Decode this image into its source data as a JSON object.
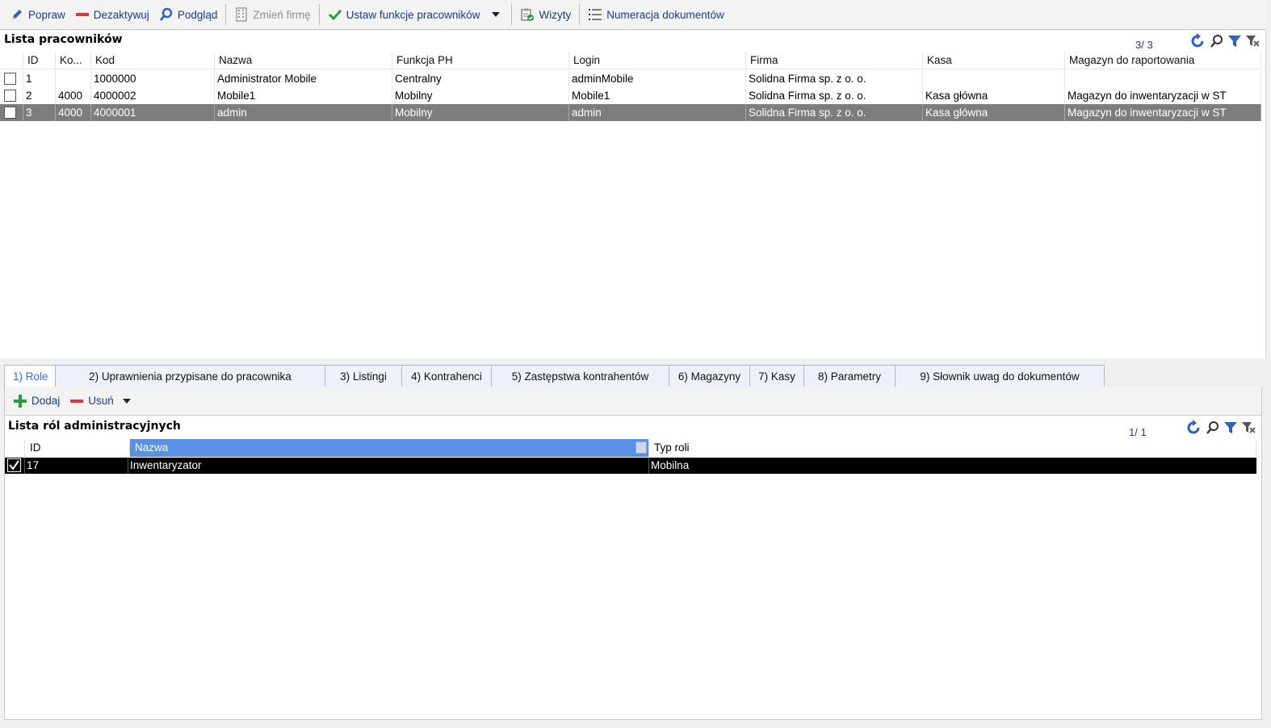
{
  "toolbar": {
    "popraw": "Popraw",
    "dezaktywuj": "Dezaktywuj",
    "podglad": "Podgląd",
    "zmien_firme": "Zmień firmę",
    "ustaw_funkcje": "Ustaw funkcje pracowników",
    "wizyty": "Wizyty",
    "numeracja": "Numeracja dokumentów"
  },
  "employees": {
    "title": "Lista pracowników",
    "counter": "3/ 3",
    "columns": [
      "ID",
      "Ko...",
      "Kod",
      "Nazwa",
      "Funkcja PH",
      "Login",
      "Firma",
      "Kasa",
      "Magazyn do raportowania"
    ],
    "rows": [
      {
        "id": "1",
        "ko": "",
        "kod": "1000000",
        "nazwa": "Administrator Mobile",
        "funkcja": "Centralny",
        "login": "adminMobile",
        "firma": "Solidna Firma sp. z o. o.",
        "kasa": "",
        "magazyn": ""
      },
      {
        "id": "2",
        "ko": "4000",
        "kod": "4000002",
        "nazwa": "Mobile1",
        "funkcja": "Mobilny",
        "login": "Mobile1",
        "firma": "Solidna Firma sp. z o. o.",
        "kasa": "Kasa główna",
        "magazyn": "Magazyn do inwentaryzacji w ST"
      },
      {
        "id": "3",
        "ko": "4000",
        "kod": "4000001",
        "nazwa": "admin",
        "funkcja": "Mobilny",
        "login": "admin",
        "firma": "Solidna Firma sp. z o. o.",
        "kasa": "Kasa główna",
        "magazyn": "Magazyn do inwentaryzacji w ST"
      }
    ]
  },
  "tabs": [
    "1) Role",
    "2) Uprawnienia przypisane do pracownika",
    "3) Listingi",
    "4) Kontrahenci",
    "5) Zastępstwa kontrahentów",
    "6) Magazyny",
    "7) Kasy",
    "8) Parametry",
    "9) Słownik uwag do dokumentów"
  ],
  "roles": {
    "dodaj": "Dodaj",
    "usun": "Usuń",
    "title": "Lista ról administracyjnych",
    "counter": "1/ 1",
    "columns": [
      "ID",
      "Nazwa",
      "Typ roli"
    ],
    "rows": [
      {
        "id": "17",
        "nazwa": "Inwentaryzator",
        "typ": "Mobilna",
        "checked": true
      }
    ]
  },
  "colors": {
    "link_blue": "#1a3a8c",
    "selected_row": "#7d7d7d",
    "sorted_header": "#5b8fe6",
    "tool_blue": "#2b62c8"
  }
}
